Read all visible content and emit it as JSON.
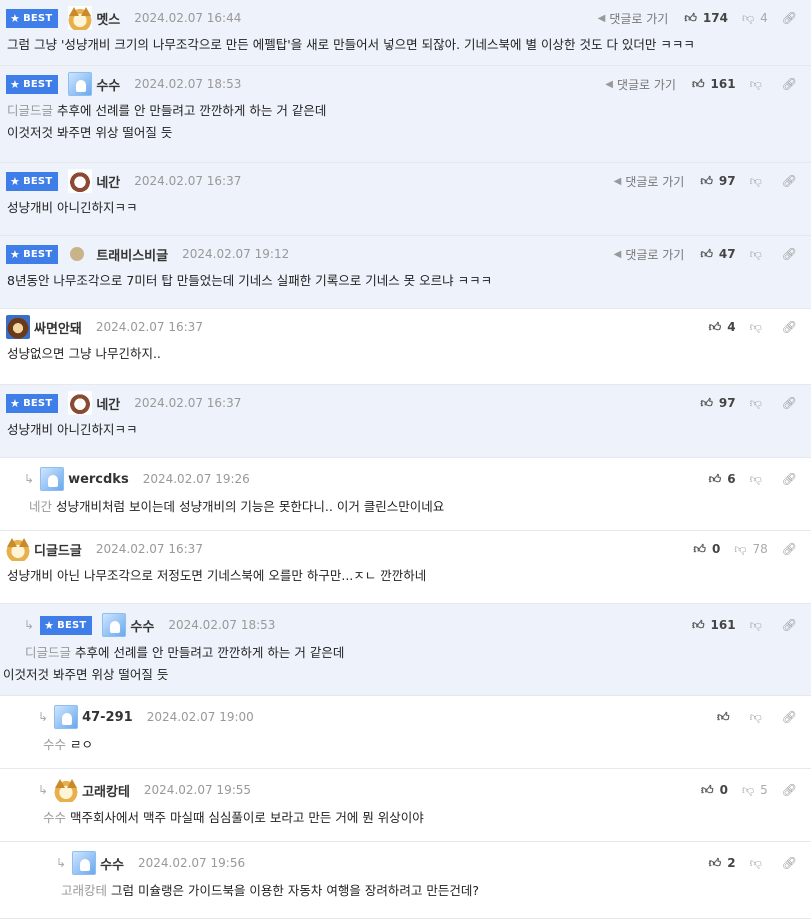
{
  "comments": [
    {
      "best": true,
      "avatar": "fox",
      "nick": "멧스",
      "date": "2024.02.07 16:44",
      "reply_label": "댓글로 가기",
      "likes": "174",
      "dislikes": "4",
      "ref": "",
      "text": "그럼 그냥 '성냥개비 크기의 나무조각으로 만든 에펠탑'을 새로 만들어서 넣으면 되잖아. 기네스북에 별 이상한 것도 다 있더만 ㅋㅋㅋ"
    },
    {
      "best": true,
      "avatar": "ghost",
      "nick": "수수",
      "date": "2024.02.07 18:53",
      "reply_label": "댓글로 가기",
      "likes": "161",
      "dislikes": "",
      "ref": "디글드글",
      "text": "추후에 선례를 안 만들려고 깐깐하게 하는 거 같은데",
      "text2": "이것저것 봐주면 위상 떨어질 듯"
    },
    {
      "best": true,
      "avatar": "dog",
      "nick": "네간",
      "date": "2024.02.07 16:37",
      "reply_label": "댓글로 가기",
      "likes": "97",
      "dislikes": "",
      "ref": "",
      "text": "성냥개비 아니긴하지ㅋㅋ"
    },
    {
      "best": true,
      "avatar": "dot",
      "nick": "트래비스비글",
      "date": "2024.02.07 19:12",
      "reply_label": "댓글로 가기",
      "likes": "47",
      "dislikes": "",
      "ref": "",
      "text": "8년동안 나무조각으로 7미터 탑 만들었는데 기네스 실패한 기록으로 기네스 못 오르냐 ㅋㅋㅋ"
    },
    {
      "best": false,
      "avatar": "lion",
      "nick": "싸면안돼",
      "date": "2024.02.07 16:37",
      "likes": "4",
      "dislikes": "",
      "ref": "",
      "text": "성냥없으면 그냥 나무긴하지.."
    },
    {
      "best": true,
      "avatar": "dog",
      "nick": "네간",
      "date": "2024.02.07 16:37",
      "likes": "97",
      "dislikes": "",
      "ref": "",
      "text": "성냥개비 아니긴하지ㅋㅋ"
    },
    {
      "best": false,
      "avatar": "ghost",
      "nick": "wercdks",
      "date": "2024.02.07 19:26",
      "likes": "6",
      "dislikes": "",
      "ref": "네간",
      "text": "성냥개비처럼 보이는데 성냥개비의 기능은 못한다니.. 이거 클린스만이네요"
    },
    {
      "best": false,
      "avatar": "fox",
      "nick": "디글드글",
      "date": "2024.02.07 16:37",
      "likes": "0",
      "dislikes": "78",
      "ref": "",
      "text": "성냥개비 아닌 나무조각으로 저정도면 기네스북에 오를만 하구만...ㅈㄴ 깐깐하네"
    },
    {
      "best": true,
      "avatar": "ghost",
      "nick": "수수",
      "date": "2024.02.07 18:53",
      "likes": "161",
      "dislikes": "",
      "ref": "디글드글",
      "text": "추후에 선례를 안 만들려고 깐깐하게 하는 거 같은데",
      "text2": "이것저것 봐주면 위상 떨어질 듯"
    },
    {
      "best": false,
      "avatar": "ghost",
      "nick": "47-291",
      "date": "2024.02.07 19:00",
      "likes": "",
      "dislikes": "",
      "ref": "수수",
      "text": "ㄹㅇ"
    },
    {
      "best": false,
      "avatar": "fox",
      "nick": "고래캉테",
      "date": "2024.02.07 19:55",
      "likes": "0",
      "dislikes": "5",
      "ref": "수수",
      "text": "맥주회사에서 맥주 마실때 심심풀이로 보라고 만든 거에 뭔 위상이야"
    },
    {
      "best": false,
      "avatar": "ghost",
      "nick": "수수",
      "date": "2024.02.07 19:56",
      "likes": "2",
      "dislikes": "",
      "ref": "고래캉테",
      "text": "그럼 미슐랭은 가이드북을 이용한 자동차 여행을 장려하려고 만든건데?"
    }
  ],
  "badge_label": "BEST",
  "colors": {
    "best_bg": "#eef2fb",
    "badge": "#3f7ee8"
  }
}
